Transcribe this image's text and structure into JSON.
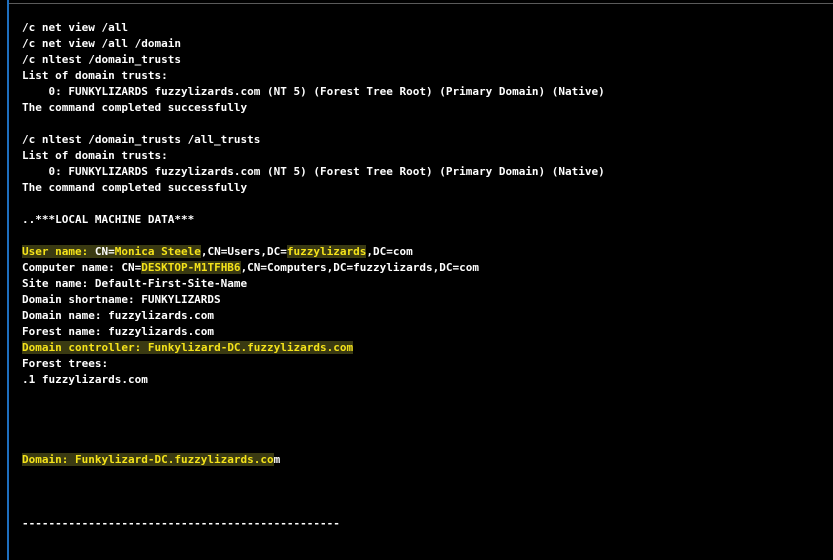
{
  "lines": [
    {
      "segments": [
        {
          "text": "/c net view /all"
        }
      ]
    },
    {
      "segments": [
        {
          "text": "/c net view /all /domain"
        }
      ]
    },
    {
      "segments": [
        {
          "text": "/c nltest /domain_trusts"
        }
      ]
    },
    {
      "segments": [
        {
          "text": "List of domain trusts:"
        }
      ]
    },
    {
      "segments": [
        {
          "text": "    0: FUNKYLIZARDS fuzzylizards.com (NT 5) (Forest Tree Root) (Primary Domain) (Native)"
        }
      ]
    },
    {
      "segments": [
        {
          "text": "The command completed successfully"
        }
      ]
    },
    {
      "segments": []
    },
    {
      "segments": [
        {
          "text": "/c nltest /domain_trusts /all_trusts"
        }
      ]
    },
    {
      "segments": [
        {
          "text": "List of domain trusts:"
        }
      ]
    },
    {
      "segments": [
        {
          "text": "    0: FUNKYLIZARDS fuzzylizards.com (NT 5) (Forest Tree Root) (Primary Domain) (Native)"
        }
      ]
    },
    {
      "segments": [
        {
          "text": "The command completed successfully"
        }
      ]
    },
    {
      "segments": []
    },
    {
      "segments": [
        {
          "text": "..***LOCAL MACHINE DATA***"
        }
      ]
    },
    {
      "segments": []
    },
    {
      "segments": [
        {
          "text": "User name:",
          "style": "yellow",
          "hl": true
        },
        {
          "text": " CN=",
          "style": "white",
          "hl": true
        },
        {
          "text": "Monica Steele",
          "style": "yellow",
          "hl": true
        },
        {
          "text": ",CN=Users,DC=",
          "style": "white"
        },
        {
          "text": "fuzzylizards",
          "style": "yellow",
          "hl": true
        },
        {
          "text": ",DC=com",
          "style": "white"
        }
      ]
    },
    {
      "segments": [
        {
          "text": "Computer name: CN=",
          "style": "white"
        },
        {
          "text": "DESKTOP-M1TFHB6",
          "style": "yellow",
          "hl": true
        },
        {
          "text": ",CN=Computers,DC=fuzzylizards,DC=com",
          "style": "white"
        }
      ]
    },
    {
      "segments": [
        {
          "text": "Site name: Default-First-Site-Name"
        }
      ]
    },
    {
      "segments": [
        {
          "text": "Domain shortname: FUNKYLIZARDS"
        }
      ]
    },
    {
      "segments": [
        {
          "text": "Domain name: fuzzylizards.com"
        }
      ]
    },
    {
      "segments": [
        {
          "text": "Forest name: fuzzylizards.com"
        }
      ]
    },
    {
      "segments": [
        {
          "text": "Domain controller:",
          "style": "yellow",
          "hl": true
        },
        {
          "text": " ",
          "style": "white",
          "hl": true
        },
        {
          "text": "Funkylizard-DC.fuzzylizards.com",
          "style": "yellow",
          "hl": true
        }
      ]
    },
    {
      "segments": [
        {
          "text": "Forest trees:"
        }
      ]
    },
    {
      "segments": [
        {
          "text": ".1 fuzzylizards.com"
        }
      ]
    },
    {
      "segments": []
    },
    {
      "segments": []
    },
    {
      "segments": []
    },
    {
      "segments": []
    },
    {
      "segments": [
        {
          "text": "Domain: Funkylizard-DC.fuzzylizards.co",
          "style": "yellow",
          "hl": true
        },
        {
          "text": "m",
          "style": "white"
        }
      ]
    },
    {
      "segments": []
    },
    {
      "segments": []
    },
    {
      "segments": []
    },
    {
      "segments": [
        {
          "text": "------------------------------------------------"
        }
      ]
    }
  ]
}
